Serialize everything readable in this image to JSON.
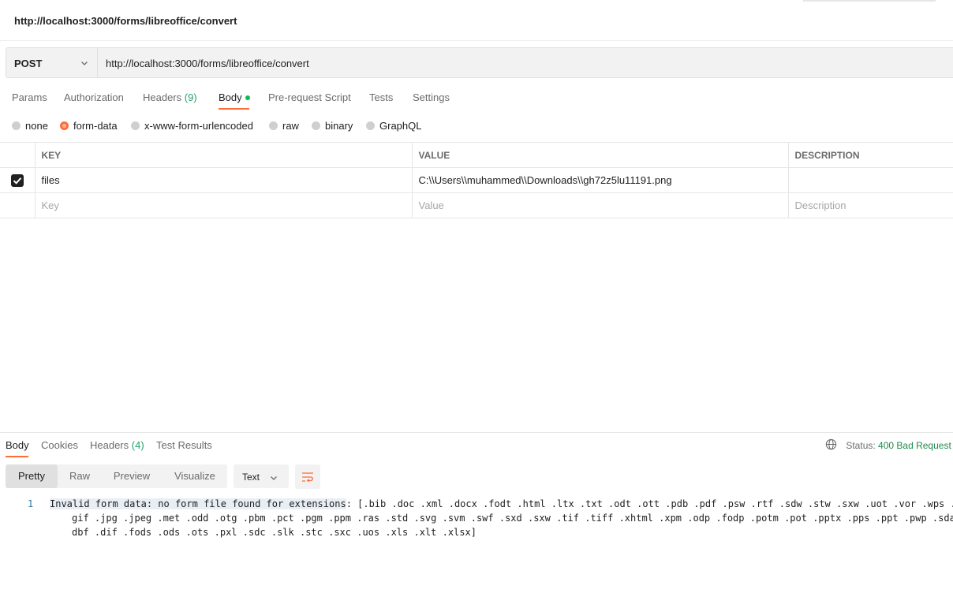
{
  "request": {
    "title": "http://localhost:3000/forms/libreoffice/convert",
    "method": "POST",
    "url": "http://localhost:3000/forms/libreoffice/convert"
  },
  "request_tabs": [
    {
      "label": "Params"
    },
    {
      "label": "Authorization"
    },
    {
      "label": "Headers",
      "count": "(9)"
    },
    {
      "label": "Body"
    },
    {
      "label": "Pre-request Script"
    },
    {
      "label": "Tests"
    },
    {
      "label": "Settings"
    }
  ],
  "body_types": [
    {
      "label": "none"
    },
    {
      "label": "form-data"
    },
    {
      "label": "x-www-form-urlencoded"
    },
    {
      "label": "raw"
    },
    {
      "label": "binary"
    },
    {
      "label": "GraphQL"
    }
  ],
  "form_table": {
    "headers": [
      "KEY",
      "VALUE",
      "DESCRIPTION"
    ],
    "rows": [
      {
        "key": "files",
        "value": "C:\\\\Users\\\\muhammed\\\\Downloads\\\\gh72z5lu11191.png",
        "description": ""
      }
    ],
    "placeholders": {
      "key": "Key",
      "value": "Value",
      "description": "Description"
    }
  },
  "response_tabs": [
    {
      "label": "Body"
    },
    {
      "label": "Cookies"
    },
    {
      "label": "Headers",
      "count": "(4)"
    },
    {
      "label": "Test Results"
    }
  ],
  "response_status": {
    "label": "Status:",
    "code": "400 Bad Request"
  },
  "view_modes": [
    "Pretty",
    "Raw",
    "Preview",
    "Visualize"
  ],
  "format_select": "Text",
  "response_body": {
    "line_number": "1",
    "highlighted": "Invalid form data: no form file found for extensions",
    "line1_rest": ": [.bib .doc .xml .docx .fodt .html .ltx .txt .odt .ott .pdb .pdf .psw .rtf .sdw .stw .sxw .uot .vor .wps .",
    "line2": "gif .jpg .jpeg .met .odd .otg .pbm .pct .pgm .ppm .ras .std .svg .svm .swf .sxd .sxw .tif .tiff .xhtml .xpm .odp .fodp .potm .pot .pptx .pps .ppt .pwp .sda",
    "line3": "dbf .dif .fods .ods .ots .pxl .sdc .slk .stc .sxc .uos .xls .xlt .xlsx]"
  },
  "colors": {
    "accent": "#ff6c37",
    "status_error_text": "#1f8a4c",
    "body_dot": "#0cbb52"
  },
  "icons": [
    "chevron-down-icon",
    "checkbox-checked-icon",
    "globe-icon",
    "word-wrap-icon"
  ]
}
